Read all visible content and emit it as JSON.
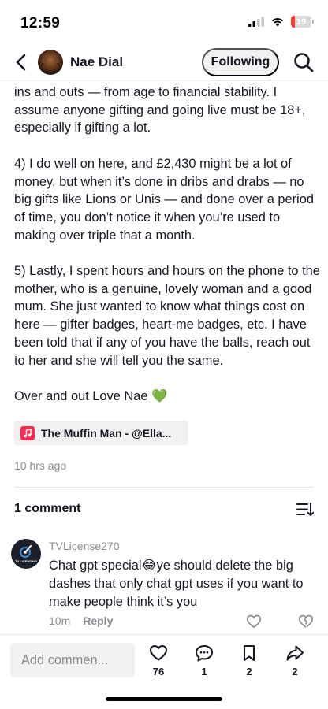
{
  "status_bar": {
    "time": "12:59",
    "battery": "19",
    "battery_level": 0.19
  },
  "header": {
    "username": "Nae Dial",
    "following_label": "Following"
  },
  "post": {
    "paragraphs": [
      "ins and outs — from age to financial stability. I assume anyone gifting and going live must be 18+, especially if gifting a lot.",
      "4) I do well on here, and £2,430 might be a lot of money, but when it’s done in dribs and drabs — no big gifts like Lions or Unis — and done over a period of time, you don’t notice it when you’re used to making over triple that a month.",
      "5) Lastly, I spent hours and hours on the phone to the mother, who is a genuine, lovely woman and a good mum. She just wanted to know what things cost on here — gifter badges, heart-me badges, etc. I have been told that if any of you have the balls, reach out to her and she will tell you the same."
    ],
    "signoff": "Over and out Love Nae",
    "signoff_emoji": "💚",
    "music": "The Muffin Man - @Ella...",
    "timestamp": "10 hrs ago"
  },
  "comments_section": {
    "count_label": "1 comment",
    "comments": [
      {
        "avatar_text": "TV LICENSING",
        "user": "TVLicense270",
        "text": "Chat gpt special😂ye should delete the big dashes that only chat gpt uses if you want to make people think it’s you",
        "time": "10m",
        "reply_label": "Reply"
      }
    ]
  },
  "bottom_bar": {
    "comment_placeholder": "Add commen...",
    "likes": "76",
    "comments": "1",
    "saves": "2",
    "shares": "2"
  },
  "colors": {
    "accent": "#fe2c55",
    "text": "#161823",
    "muted": "#8a8b91",
    "chip_bg": "#f1f1f2",
    "battery_low": "#ff3b30"
  },
  "icons": [
    "back-arrow-icon",
    "search-icon",
    "music-note-icon",
    "sort-icon",
    "heart-icon",
    "broken-heart-icon",
    "comment-icon",
    "bookmark-icon",
    "share-icon",
    "signal-icon",
    "wifi-icon",
    "battery-icon"
  ]
}
